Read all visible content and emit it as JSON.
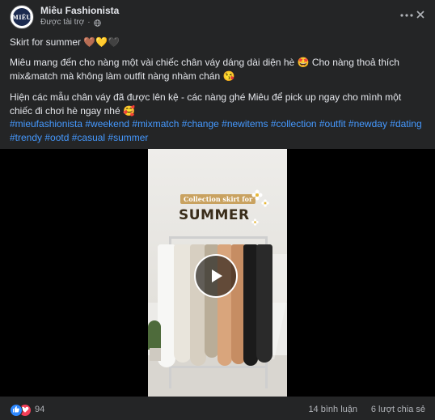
{
  "post": {
    "page_name": "Miêu Fashionista",
    "sponsored_label": "Được tài trợ",
    "avatar_text": "MIÊU",
    "lines": {
      "title": "Skirt for summer 🤎💛🖤",
      "paragraph1": "Miêu mang đến cho nàng một vài chiếc chân váy dáng dài diện hè 🤩 Cho nàng thoả thích mix&match mà không làm outfit nàng nhàm chán 😘",
      "paragraph2": "Hiện các mẫu chân váy đã được lên kệ - các nàng ghé Miêu để pick up ngay cho mình một chiếc đi chơi hè ngay nhé 🥰",
      "hashtags": "#mieufashionista #weekend #mixmatch #change #newitems #collection #outfit #newday #dating #trendy #ootd #casual #summer"
    }
  },
  "video": {
    "overlay_small": "Collection skirt for",
    "overlay_big": "SUMMER"
  },
  "footer": {
    "reaction_count": "94",
    "comments": "14 bình luận",
    "shares": "6 lượt chia sẻ"
  },
  "icons": {
    "globe": "globe-icon",
    "more": "more-icon",
    "close": "close-icon",
    "play": "play-icon",
    "like": "like-icon",
    "love": "love-icon"
  },
  "colors": {
    "background": "#242526",
    "text": "#e4e6eb",
    "secondary": "#b0b3b8",
    "hashtag": "#4599ff",
    "like": "#2d88ff",
    "love": "#f33e58"
  }
}
